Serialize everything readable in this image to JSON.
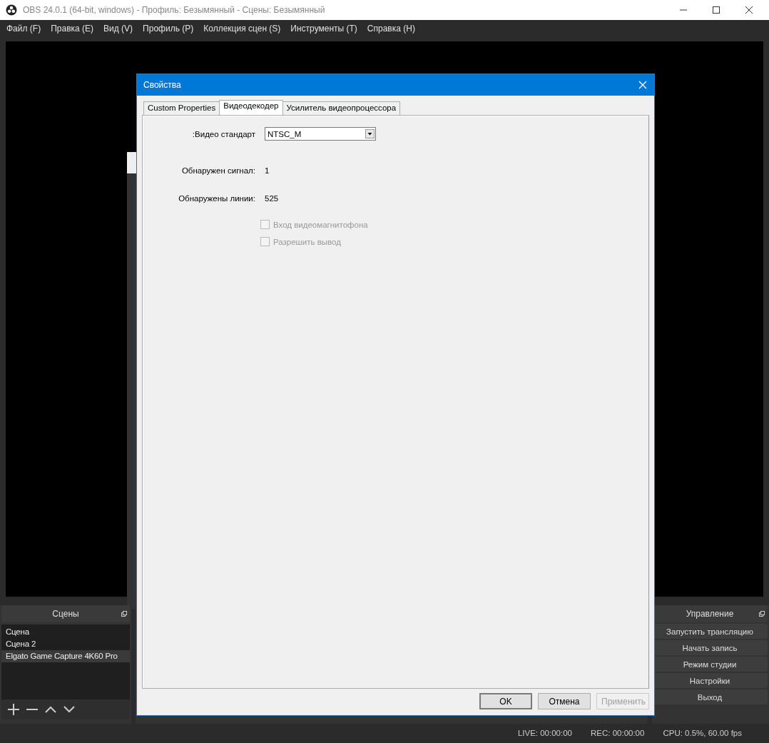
{
  "window": {
    "title": "OBS 24.0.1 (64-bit, windows) - Профиль: Безымянный - Сцены: Безымянный"
  },
  "menu": [
    "Файл (F)",
    "Правка (E)",
    "Вид (V)",
    "Профиль (P)",
    "Коллекция сцен (S)",
    "Инструменты (T)",
    "Справка (H)"
  ],
  "scenes_dock": {
    "title": "Сцены",
    "items": [
      {
        "label": "Сцена",
        "selected": false
      },
      {
        "label": "Сцена 2",
        "selected": false
      },
      {
        "label": "Elgato Game Capture 4K60 Pro",
        "selected": true
      }
    ]
  },
  "controls_dock": {
    "title": "Управление",
    "buttons": [
      "Запустить трансляцию",
      "Начать запись",
      "Режим студии",
      "Настройки",
      "Выход"
    ]
  },
  "status_bar": [
    "LIVE: 00:00:00",
    "REC: 00:00:00",
    "CPU: 0.5%, 60.00 fps"
  ],
  "dialog": {
    "title": "Свойства",
    "tabs": [
      {
        "label": "Custom Properties",
        "selected": false
      },
      {
        "label": "Видеодекодер",
        "selected": true
      },
      {
        "label": "Усилитель видеопроцессора",
        "selected": false
      }
    ],
    "fields": [
      {
        "kind": "dropdown",
        "label": ":Видео стандарт",
        "value": "NTSC_M"
      },
      {
        "kind": "readout",
        "label": "Обнаружен сигнал:",
        "value": "1"
      },
      {
        "kind": "readout",
        "label": "Обнаружены линии:",
        "value": "525"
      }
    ],
    "checkboxes": [
      {
        "label": "Вход видеомагнитофона",
        "checked": false,
        "disabled": true
      },
      {
        "label": "Разрешить вывод",
        "checked": false,
        "disabled": true
      }
    ],
    "buttons": [
      {
        "label": "OK",
        "default": true,
        "disabled": false
      },
      {
        "label": "Отмена",
        "default": false,
        "disabled": false
      },
      {
        "label": "Применить",
        "default": false,
        "disabled": true
      }
    ]
  }
}
